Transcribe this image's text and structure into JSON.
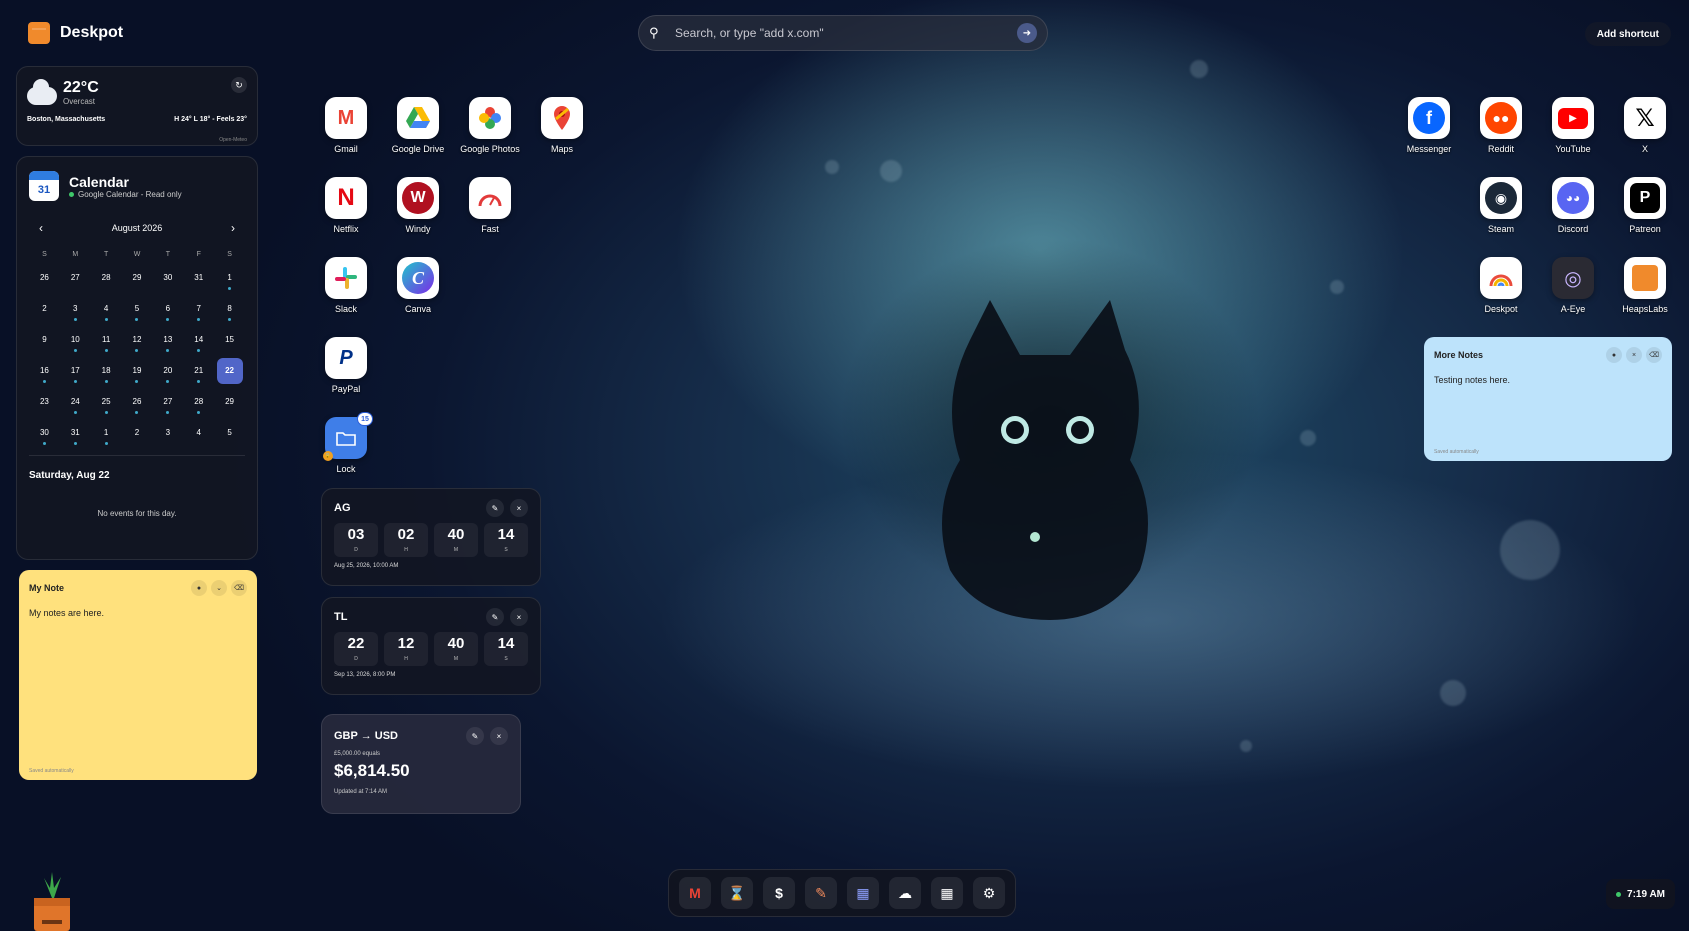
{
  "brand": {
    "name": "Deskpot"
  },
  "search": {
    "placeholder": "Search, or type \"add x.com\""
  },
  "add_shortcut_label": "Add shortcut",
  "weather": {
    "temperature": "22°C",
    "condition": "Overcast",
    "location": "Boston, Massachusetts",
    "range": "H 24° L 18° - Feels 23°",
    "source": "Open-Meteo"
  },
  "calendar": {
    "title": "Calendar",
    "badge_day": "31",
    "subtitle": "Google Calendar - Read only",
    "month_label": "August 2026",
    "weekdays": [
      "S",
      "M",
      "T",
      "W",
      "T",
      "F",
      "S"
    ],
    "weeks": [
      [
        "26",
        "27",
        "28",
        "29",
        "30",
        "31",
        "1"
      ],
      [
        "2",
        "3",
        "4",
        "5",
        "6",
        "7",
        "8"
      ],
      [
        "9",
        "10",
        "11",
        "12",
        "13",
        "14",
        "15"
      ],
      [
        "16",
        "17",
        "18",
        "19",
        "20",
        "21",
        "22"
      ],
      [
        "23",
        "24",
        "25",
        "26",
        "27",
        "28",
        "29"
      ],
      [
        "30",
        "31",
        "1",
        "2",
        "3",
        "4",
        "5"
      ]
    ],
    "selected_day": "22",
    "selected_label": "Saturday, Aug 22",
    "empty_text": "No events for this day."
  },
  "notes": {
    "my_note": {
      "title": "My Note",
      "body": "My notes are here.",
      "footer": "Saved automatically"
    },
    "more_notes": {
      "title": "More Notes",
      "body": "Testing notes here.",
      "footer": "Saved automatically"
    }
  },
  "apps_left": [
    {
      "label": "Gmail",
      "icon": "gmail-icon"
    },
    {
      "label": "Google Drive",
      "icon": "google-drive-icon"
    },
    {
      "label": "Google Photos",
      "icon": "google-photos-icon"
    },
    {
      "label": "Maps",
      "icon": "maps-icon"
    },
    {
      "label": "Netflix",
      "icon": "netflix-icon"
    },
    {
      "label": "Windy",
      "icon": "windy-icon"
    },
    {
      "label": "Fast",
      "icon": "fast-icon"
    },
    {
      "label": "Slack",
      "icon": "slack-icon"
    },
    {
      "label": "Canva",
      "icon": "canva-icon"
    },
    {
      "label": "PayPal",
      "icon": "paypal-icon"
    },
    {
      "label": "Lock",
      "icon": "folder-icon",
      "badge": "15"
    }
  ],
  "apps_right": [
    {
      "label": "Messenger",
      "icon": "messenger-icon"
    },
    {
      "label": "Reddit",
      "icon": "reddit-icon"
    },
    {
      "label": "YouTube",
      "icon": "youtube-icon"
    },
    {
      "label": "X",
      "icon": "x-icon"
    },
    {
      "label": "Steam",
      "icon": "steam-icon"
    },
    {
      "label": "Discord",
      "icon": "discord-icon"
    },
    {
      "label": "Patreon",
      "icon": "patreon-icon"
    },
    {
      "label": "Deskpot",
      "icon": "deskpot-icon"
    },
    {
      "label": "A-Eye",
      "icon": "a-eye-icon"
    },
    {
      "label": "HeapsLabs",
      "icon": "heapslabs-icon"
    }
  ],
  "timers": [
    {
      "name": "AG",
      "d": "03",
      "h": "02",
      "m": "40",
      "s": "14",
      "date": "Aug 25, 2026, 10:00 AM"
    },
    {
      "name": "TL",
      "d": "22",
      "h": "12",
      "m": "40",
      "s": "14",
      "date": "Sep 13, 2026, 8:00 PM"
    }
  ],
  "timer_units": {
    "d": "D",
    "h": "H",
    "m": "M",
    "s": "S"
  },
  "currency": {
    "pair": "GBP → USD",
    "amount_label": "£5,000.00 equals",
    "value": "$6,814.50",
    "updated": "Updated at 7:14 AM"
  },
  "dock": [
    {
      "icon": "gmail-icon",
      "glyph": "M"
    },
    {
      "icon": "hourglass-icon",
      "glyph": "⌛"
    },
    {
      "icon": "dollar-icon",
      "glyph": "$"
    },
    {
      "icon": "note-icon",
      "glyph": "✎"
    },
    {
      "icon": "calendar-icon",
      "glyph": "▦"
    },
    {
      "icon": "weather-icon",
      "glyph": "☁"
    },
    {
      "icon": "calculator-icon",
      "glyph": "▦"
    },
    {
      "icon": "settings-icon",
      "glyph": "⚙"
    }
  ],
  "clock": {
    "time": "7:19 AM"
  },
  "colors": {
    "accent": "#5166c8",
    "note_yellow": "#ffe17d",
    "note_blue": "#bde3fb",
    "brand": "#f08a2c"
  }
}
